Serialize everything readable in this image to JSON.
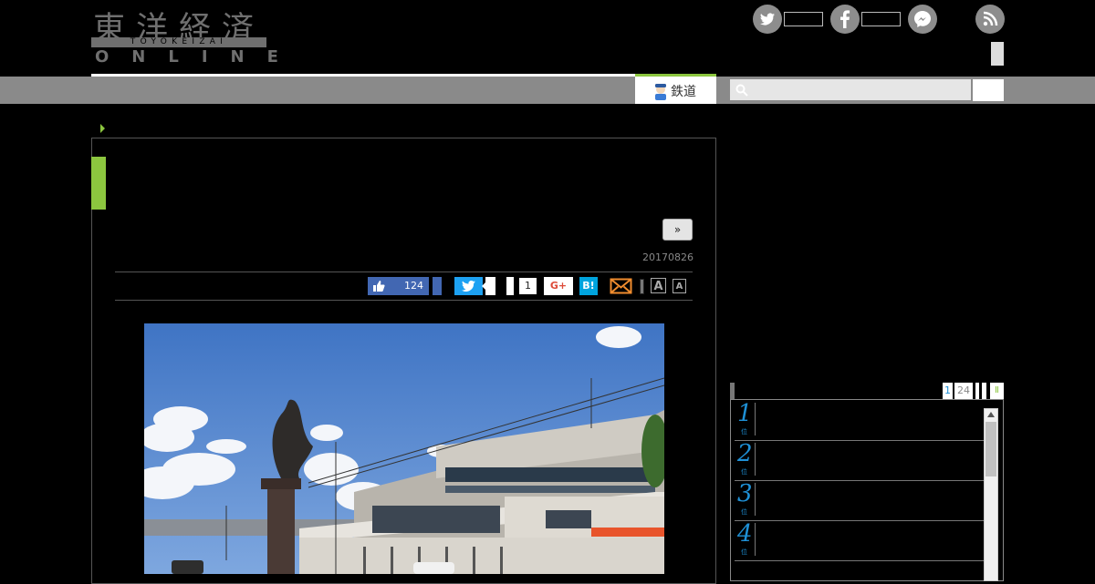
{
  "header": {
    "logo_kanji": "東洋経済",
    "logo_romaji": "TOYOKEIZAI",
    "logo_online": "ONLINE"
  },
  "nav": {
    "tab_label": "鉄道",
    "search_placeholder": ""
  },
  "article": {
    "next_label": "»",
    "date": "20170826",
    "like_count": "124",
    "line_count": "1",
    "gplus_label": "G+",
    "hatena_label": "B!",
    "font_big_label": "A",
    "font_small_label": "A"
  },
  "sidebar": {
    "ranking_tabs": [
      "1",
      "24",
      "",
      "",
      "Ⅱ"
    ],
    "ranking": [
      {
        "num": "1",
        "sub": "位"
      },
      {
        "num": "2",
        "sub": "位"
      },
      {
        "num": "3",
        "sub": "位"
      },
      {
        "num": "4",
        "sub": "位"
      }
    ]
  },
  "colors": {
    "accent_green": "#8cc63f",
    "facebook_blue": "#4267b2",
    "twitter_blue": "#1da1f2",
    "hatena_blue": "#00a4de",
    "rank_blue": "#1e90d6"
  }
}
